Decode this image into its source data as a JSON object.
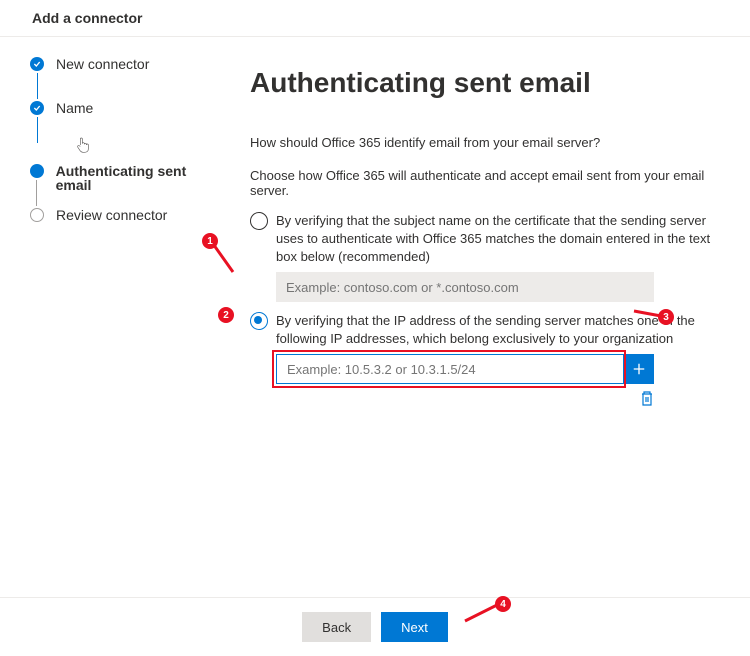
{
  "header": {
    "title": "Add a connector"
  },
  "steps": [
    {
      "label": "New connector"
    },
    {
      "label": "Name"
    },
    {
      "label": "Authenticating sent email"
    },
    {
      "label": "Review connector"
    }
  ],
  "page": {
    "title": "Authenticating sent email",
    "question1": "How should Office 365 identify email from your email server?",
    "question2": "Choose how Office 365 will authenticate and accept email sent from your email server.",
    "option1": "By verifying that the subject name on the certificate that the sending server uses to authenticate with Office 365 matches the domain entered in the text box below (recommended)",
    "domain_placeholder": "Example: contoso.com or *.contoso.com",
    "option2": "By verifying that the IP address of the sending server matches one of the following IP addresses, which belong exclusively to your organization",
    "ip_placeholder": "Example: 10.5.3.2 or 10.3.1.5/24"
  },
  "footer": {
    "back_label": "Back",
    "next_label": "Next"
  },
  "annotations": {
    "a1": "1",
    "a2": "2",
    "a3": "3",
    "a4": "4"
  },
  "colors": {
    "primary": "#0078d4",
    "annotation": "#e81123"
  }
}
